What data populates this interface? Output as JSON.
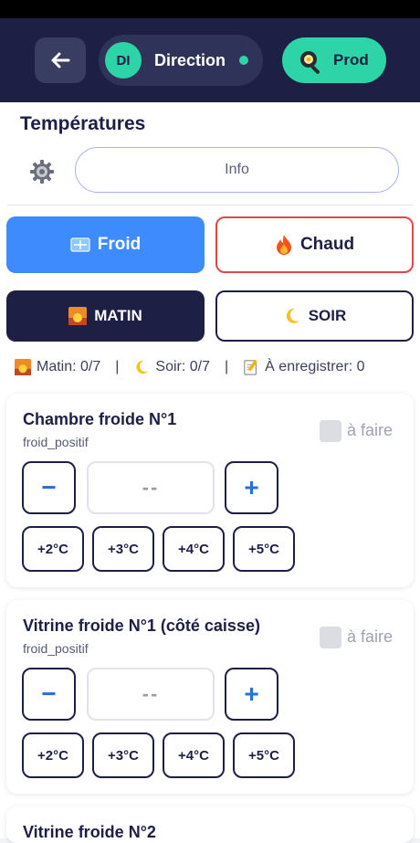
{
  "header": {
    "user_initials": "DI",
    "user_name": "Direction",
    "prod_label": "Prod"
  },
  "page": {
    "title": "Températures",
    "info_label": "Info"
  },
  "mode": {
    "froid_label": "Froid",
    "chaud_label": "Chaud",
    "matin_label": "MATIN",
    "soir_label": "SOIR",
    "selected_type": "Froid",
    "selected_period": "MATIN"
  },
  "counters": {
    "matin": "Matin: 0/7",
    "soir": "Soir: 0/7",
    "to_save": "À enregistrer: 0"
  },
  "cards": [
    {
      "name": "Chambre froide N°1",
      "type": "froid_positif",
      "todo_label": "à faire",
      "value": "--",
      "minus": "−",
      "plus": "+",
      "presets": [
        "+2°C",
        "+3°C",
        "+4°C",
        "+5°C"
      ]
    },
    {
      "name": "Vitrine froide N°1 (côté caisse)",
      "type": "froid_positif",
      "todo_label": "à faire",
      "value": "--",
      "minus": "−",
      "plus": "+",
      "presets": [
        "+2°C",
        "+3°C",
        "+4°C",
        "+5°C"
      ]
    },
    {
      "name": "Vitrine froide N°2"
    }
  ],
  "colors": {
    "header_bg": "#1d1f45",
    "accent_green": "#2dd4a7",
    "froid_blue": "#3d8bfd",
    "chaud_red": "#e04848"
  }
}
